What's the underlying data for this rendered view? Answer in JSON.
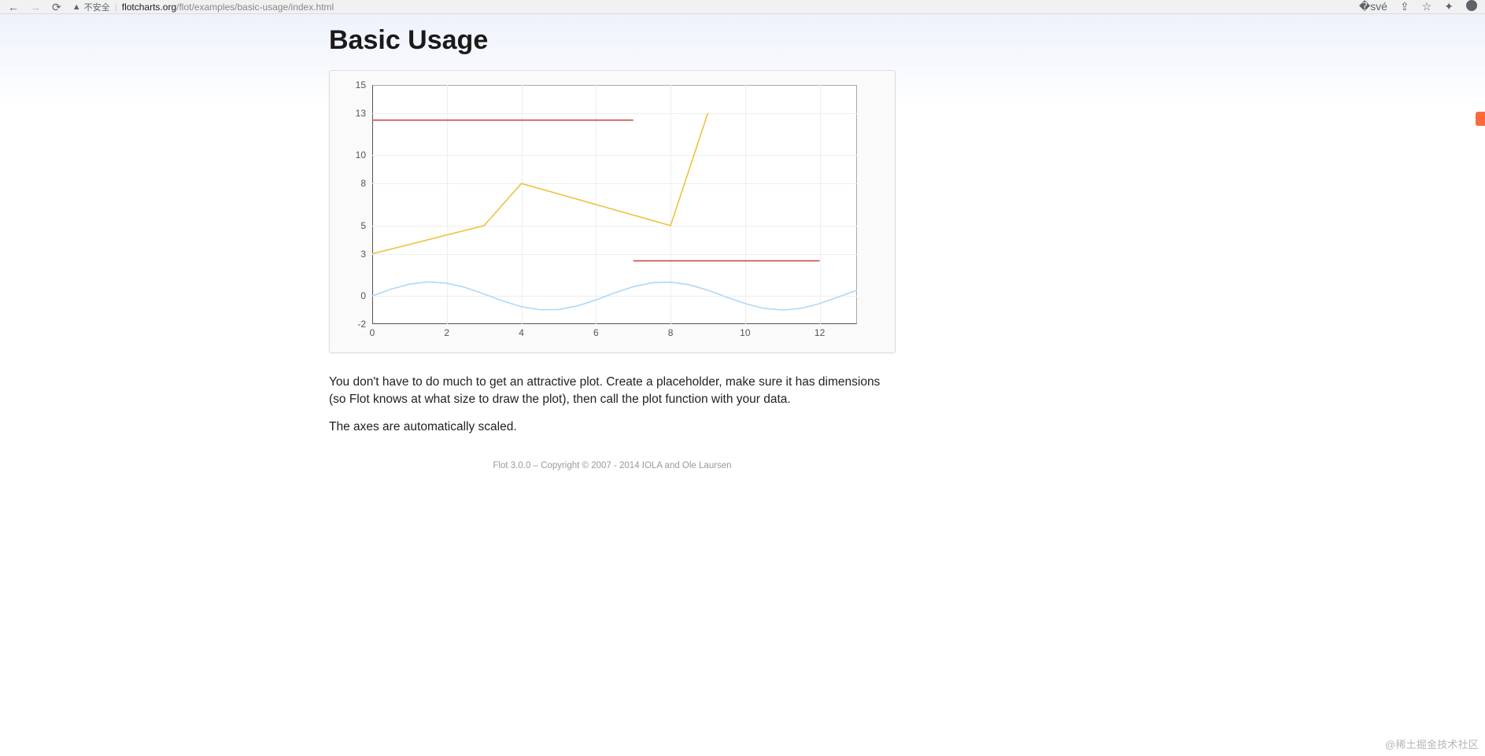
{
  "browser": {
    "insecure_label": "不安全",
    "url_host": "flotcharts.org",
    "url_path": "/flot/examples/basic-usage/index.html"
  },
  "page": {
    "title": "Basic Usage",
    "paragraph1": "You don't have to do much to get an attractive plot. Create a placeholder, make sure it has dimensions (so Flot knows at what size to draw the plot), then call the plot function with your data.",
    "paragraph2": "The axes are automatically scaled.",
    "footer": "Flot 3.0.0 – Copyright © 2007 - 2014 IOLA and Ole Laursen",
    "watermark": "@稀土掘金技术社区"
  },
  "chart_data": {
    "type": "line",
    "xlim": [
      0,
      13
    ],
    "ylim": [
      -2,
      15
    ],
    "x_ticks": [
      0,
      2,
      4,
      6,
      8,
      10,
      12
    ],
    "y_ticks": [
      -2,
      0,
      3,
      5,
      8,
      10,
      13,
      15
    ],
    "series": [
      {
        "name": "d1",
        "color": "#afd8f8",
        "x": [
          0.0,
          0.5,
          1.0,
          1.5,
          2.0,
          2.5,
          3.0,
          3.5,
          4.0,
          4.5,
          5.0,
          5.5,
          6.0,
          6.5,
          7.0,
          7.5,
          8.0,
          8.5,
          9.0,
          9.5,
          10.0,
          10.5,
          11.0,
          11.5,
          12.0,
          12.5,
          13.0
        ],
        "y": [
          0.0,
          0.48,
          0.84,
          1.0,
          0.91,
          0.6,
          0.14,
          -0.35,
          -0.76,
          -0.98,
          -0.96,
          -0.71,
          -0.28,
          0.22,
          0.66,
          0.94,
          0.99,
          0.8,
          0.41,
          -0.08,
          -0.54,
          -0.88,
          -1.0,
          -0.88,
          -0.54,
          -0.07,
          0.42
        ]
      },
      {
        "name": "d2",
        "color": "#edc240",
        "x": [
          0,
          3,
          4,
          8,
          9
        ],
        "y": [
          3,
          5,
          8,
          5,
          13
        ]
      },
      {
        "name": "d3",
        "color": "#cb4b4b",
        "segments": [
          {
            "x": [
              0,
              7
            ],
            "y": [
              12.5,
              12.5
            ]
          },
          {
            "x": [
              7,
              12
            ],
            "y": [
              2.5,
              2.5
            ]
          }
        ]
      }
    ],
    "title": "",
    "xlabel": "",
    "ylabel": ""
  }
}
